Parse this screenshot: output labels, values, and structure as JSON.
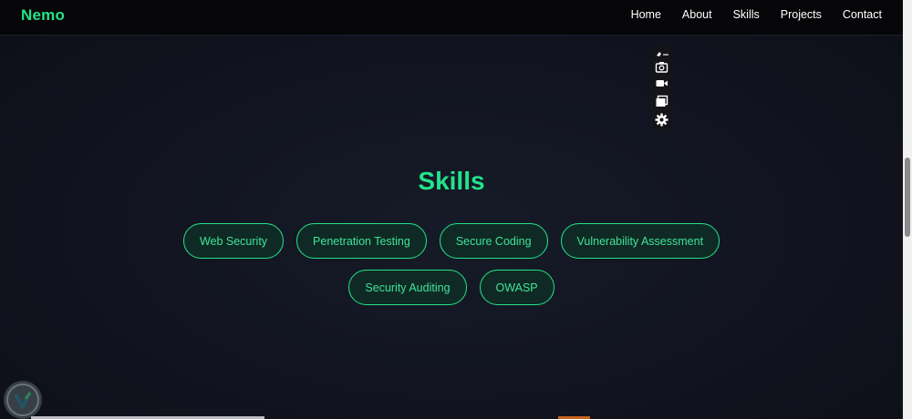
{
  "navbar": {
    "brand": "Nemo",
    "links": [
      "Home",
      "About",
      "Skills",
      "Projects",
      "Contact"
    ]
  },
  "tool_panel": {
    "icons": [
      "screenshot-tools-icon",
      "camera-icon",
      "video-icon",
      "window-icon",
      "gear-icon"
    ]
  },
  "skills": {
    "title": "Skills",
    "items": [
      "Web Security",
      "Penetration Testing",
      "Secure Coding",
      "Vulnerability Assessment",
      "Security Auditing",
      "OWASP"
    ]
  },
  "colors": {
    "accent": "#22e38a",
    "background": "#121521",
    "navbar": "#060608",
    "pill_fill": "#0f2a24"
  }
}
